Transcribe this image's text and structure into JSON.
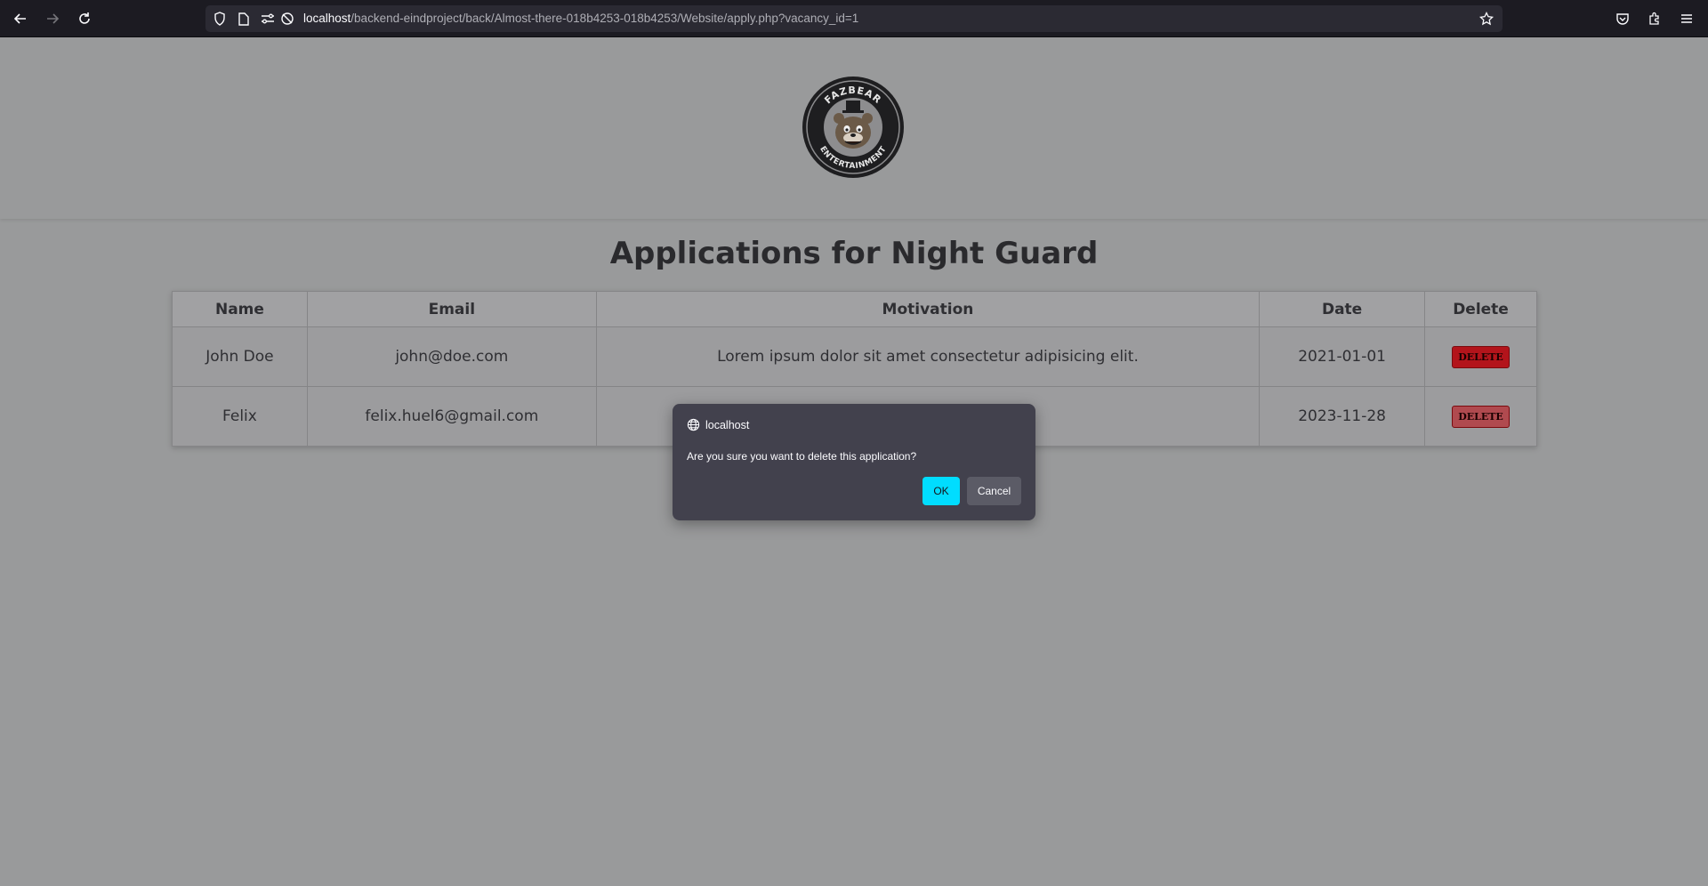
{
  "browser": {
    "url_host": "localhost",
    "url_path": "/backend-eindproject/back/Almost-there-018b4253-018b4253/Website/apply.php?vacancy_id=1",
    "icons": [
      "back-icon",
      "forward-icon",
      "reload-icon",
      "shield-icon",
      "page-icon",
      "permissions-icon",
      "tracking-protection-icon",
      "bookmark-star-icon",
      "pocket-icon",
      "extensions-icon",
      "menu-icon"
    ]
  },
  "logo": {
    "text_top": "FAZBEAR",
    "text_bottom": "ENTERTAINMENT"
  },
  "page": {
    "title": "Applications for Night Guard"
  },
  "table": {
    "headers": {
      "name": "Name",
      "email": "Email",
      "motivation": "Motivation",
      "date": "Date",
      "delete": "Delete"
    },
    "rows": [
      {
        "name": "John Doe",
        "email": "john@doe.com",
        "motivation": "Lorem ipsum dolor sit amet consectetur adipisicing elit.",
        "date": "2021-01-01",
        "delete_label": "DELETE"
      },
      {
        "name": "Felix",
        "email": "felix.huel6@gmail.com",
        "motivation": "",
        "date": "2023-11-28",
        "delete_label": "DELETE"
      }
    ]
  },
  "dialog": {
    "origin": "localhost",
    "message": "Are you sure you want to delete this application?",
    "ok_label": "OK",
    "cancel_label": "Cancel"
  },
  "colors": {
    "ok_button": "#00ddff",
    "delete_button": "#b3141b",
    "dialog_bg": "#42414d"
  }
}
